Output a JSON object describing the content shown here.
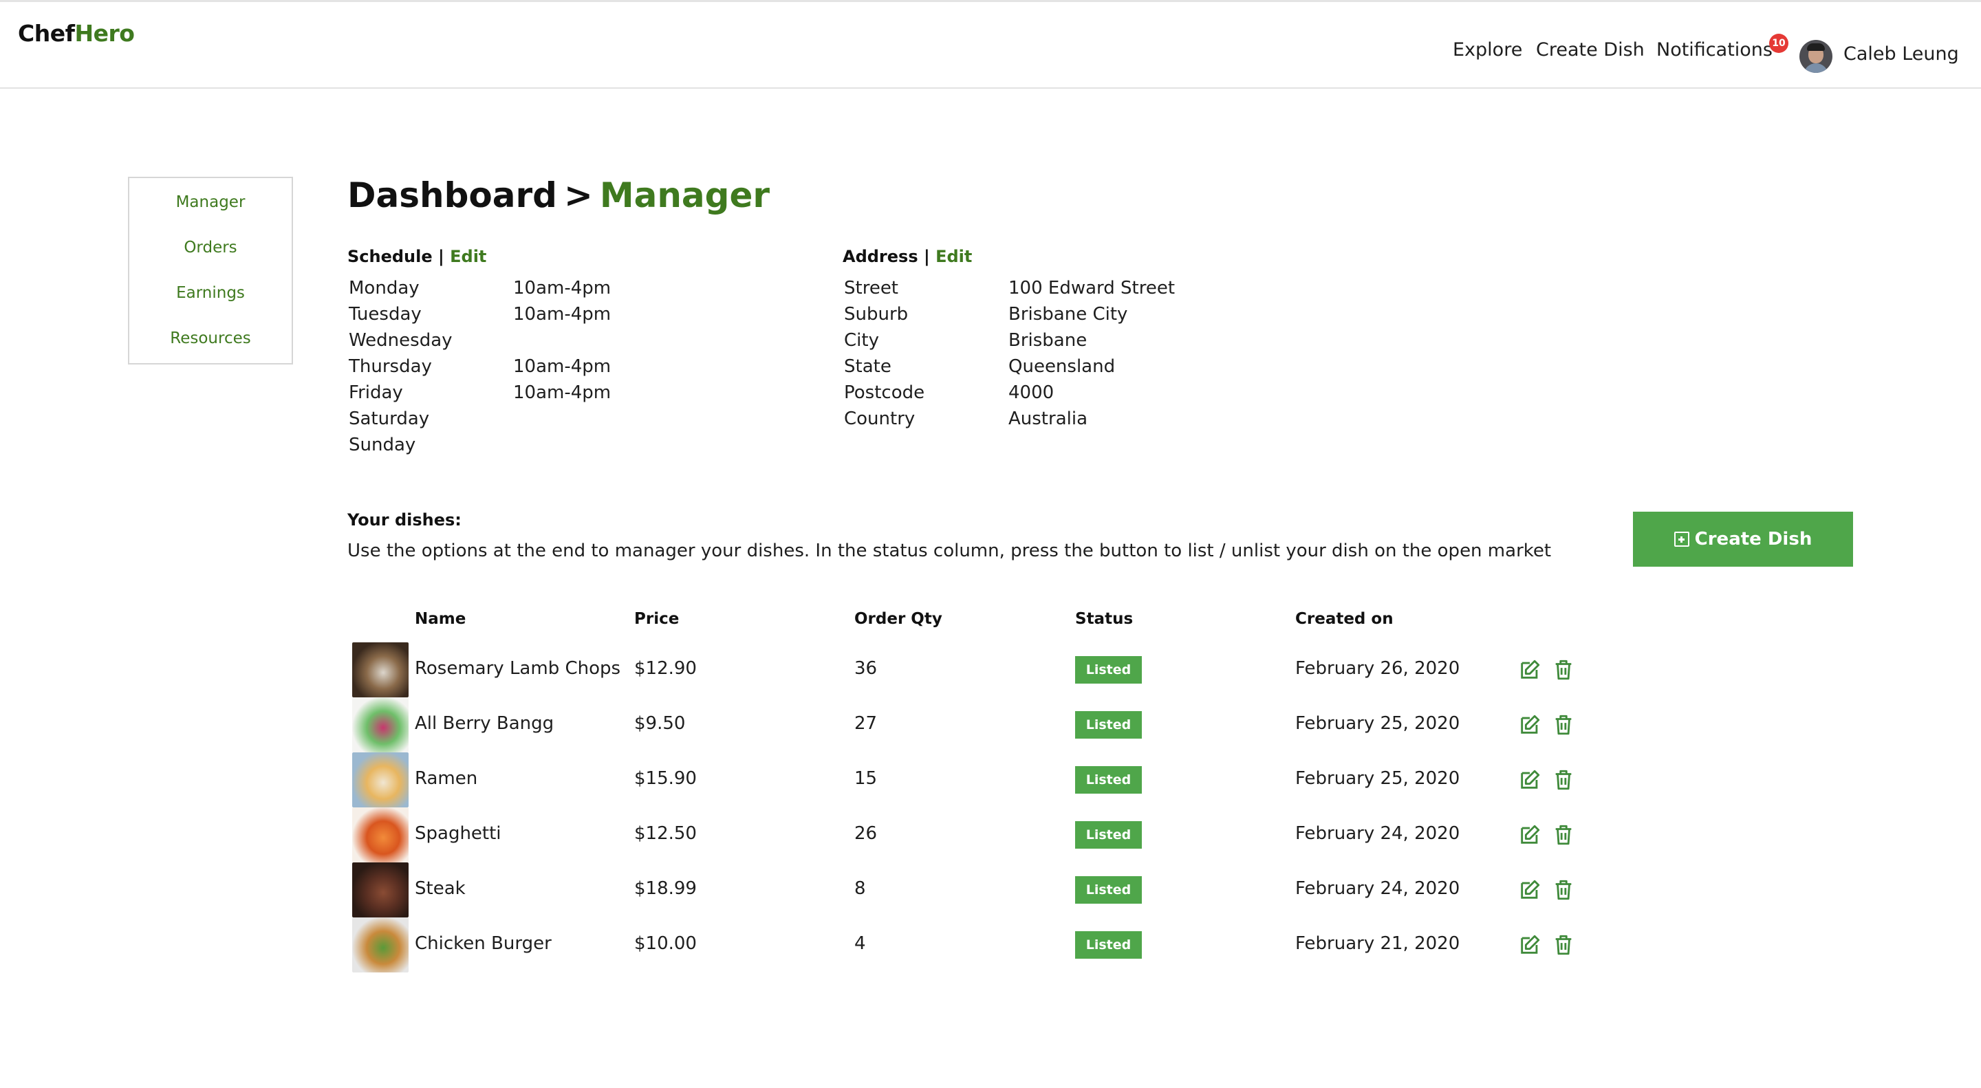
{
  "app": {
    "brand_part1": "Chef",
    "brand_part2": "Hero"
  },
  "nav": {
    "explore": "Explore",
    "create_dish": "Create Dish",
    "notifications": "Notifications",
    "notification_count": "10",
    "user_name": "Caleb Leung"
  },
  "sidebar": {
    "items": [
      {
        "label": "Manager"
      },
      {
        "label": "Orders"
      },
      {
        "label": "Earnings"
      },
      {
        "label": "Resources"
      }
    ]
  },
  "title": {
    "part1": "Dashboard",
    "separator": ">",
    "part2": "Manager"
  },
  "schedule": {
    "heading": "Schedule |",
    "edit": "Edit",
    "days": [
      {
        "day": "Monday",
        "hours": "10am-4pm"
      },
      {
        "day": "Tuesday",
        "hours": "10am-4pm"
      },
      {
        "day": "Wednesday",
        "hours": ""
      },
      {
        "day": "Thursday",
        "hours": "10am-4pm"
      },
      {
        "day": "Friday",
        "hours": "10am-4pm"
      },
      {
        "day": "Saturday",
        "hours": ""
      },
      {
        "day": "Sunday",
        "hours": ""
      }
    ]
  },
  "address": {
    "heading": "Address |",
    "edit": "Edit",
    "rows": [
      {
        "label": "Street",
        "value": "100 Edward Street"
      },
      {
        "label": "Suburb",
        "value": "Brisbane City"
      },
      {
        "label": "City",
        "value": "Brisbane"
      },
      {
        "label": "State",
        "value": "Queensland"
      },
      {
        "label": "Postcode",
        "value": "4000"
      },
      {
        "label": "Country",
        "value": "Australia"
      }
    ]
  },
  "dishes": {
    "label": "Your dishes:",
    "description": "Use the options at the end to manager your dishes. In the status column, press the button to list / unlist your dish on the open market",
    "create_button": "Create Dish",
    "columns": {
      "name": "Name",
      "price": "Price",
      "order_qty": "Order Qty",
      "status": "Status",
      "created_on": "Created on"
    },
    "rows": [
      {
        "name": "Rosemary Lamb Chops",
        "price": "$12.90",
        "qty": "36",
        "status": "Listed",
        "created": "February 26, 2020",
        "thumb_colors": [
          "#3a2a1e",
          "#8a6a4a",
          "#dcd6cc"
        ]
      },
      {
        "name": "All Berry Bangg",
        "price": "$9.50",
        "qty": "27",
        "status": "Listed",
        "created": "February 25, 2020",
        "thumb_colors": [
          "#f4f4f2",
          "#6fbf6a",
          "#c8366e"
        ]
      },
      {
        "name": "Ramen",
        "price": "$15.90",
        "qty": "15",
        "status": "Listed",
        "created": "February 25, 2020",
        "thumb_colors": [
          "#9bb8d0",
          "#e8b660",
          "#f0e6d2"
        ]
      },
      {
        "name": "Spaghetti",
        "price": "$12.50",
        "qty": "26",
        "status": "Listed",
        "created": "February 24, 2020",
        "thumb_colors": [
          "#f6efe8",
          "#d9561f",
          "#f28b3a"
        ]
      },
      {
        "name": "Steak",
        "price": "$18.99",
        "qty": "8",
        "status": "Listed",
        "created": "February 24, 2020",
        "thumb_colors": [
          "#2a1a14",
          "#5a2f22",
          "#8a4c34"
        ]
      },
      {
        "name": "Chicken Burger",
        "price": "$10.00",
        "qty": "4",
        "status": "Listed",
        "created": "February 21, 2020",
        "thumb_colors": [
          "#e6e6e6",
          "#c98a3c",
          "#5a9a3a"
        ]
      }
    ]
  },
  "colors": {
    "brand_green": "#3f7a1f",
    "button_green": "#4fa64a",
    "badge_red": "#e53935"
  },
  "icons": [
    "edit-icon",
    "trash-icon"
  ]
}
